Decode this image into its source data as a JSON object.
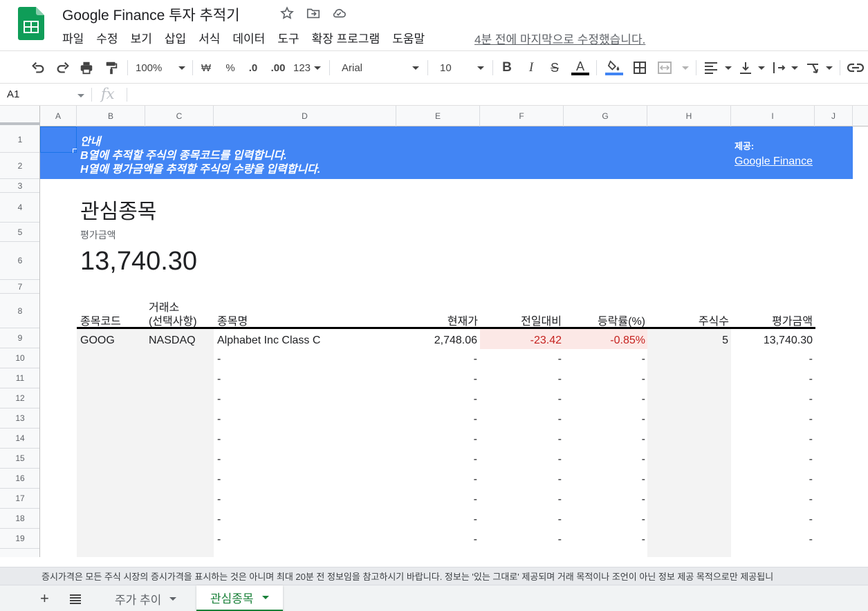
{
  "app": {
    "title": "Google Finance 투자 추적기",
    "last_edit": "4분 전에 마지막으로 수정했습니다."
  },
  "menu": [
    "파일",
    "수정",
    "보기",
    "삽입",
    "서식",
    "데이터",
    "도구",
    "확장 프로그램",
    "도움말"
  ],
  "toolbar": {
    "zoom": "100%",
    "currency": "₩",
    "percent": "%",
    "dec_decrease": ".0",
    "dec_increase": ".00",
    "format_more": "123",
    "font": "Arial",
    "font_size": "10"
  },
  "formula_bar": {
    "cell_ref": "A1",
    "fx": "fx"
  },
  "columns": [
    "A",
    "B",
    "C",
    "D",
    "E",
    "F",
    "G",
    "H",
    "I",
    "J"
  ],
  "rows": [
    "1",
    "2",
    "3",
    "4",
    "5",
    "6",
    "7",
    "8",
    "9",
    "10",
    "11",
    "12",
    "13",
    "14",
    "15",
    "16",
    "17",
    "18",
    "19"
  ],
  "banner": {
    "heading": "안내",
    "line1": "B열에 추적할 주식의 종목코드를 입력합니다.",
    "line2": "H열에 평가금액을 추적할 주식의 수량을 입력합니다.",
    "provided_label": "제공:",
    "provided_link": "Google Finance",
    "color": "#4285f4"
  },
  "summary": {
    "title": "관심종목",
    "value_label": "평가금액",
    "value": "13,740.30"
  },
  "table": {
    "headers": {
      "ticker": "종목코드",
      "exchange_line1": "거래소",
      "exchange_line2": "(선택사항)",
      "name": "종목명",
      "price": "현재가",
      "change": "전일대비",
      "change_pct": "등락률(%)",
      "shares": "주식수",
      "value": "평가금액"
    },
    "row": {
      "ticker": "GOOG",
      "exchange": "NASDAQ",
      "name": "Alphabet Inc Class C",
      "price": "2,748.06",
      "change": "-23.42",
      "change_pct": "-0.85%",
      "shares": "5",
      "value": "13,740.30"
    },
    "empty_placeholder": "-",
    "negative_color": "#c5221f",
    "negative_bg": "#fce8e6"
  },
  "disclaimer": "증시가격은 모든 주식 시장의 증시가격을 표시하는 것은 아니며 최대 20분 전 정보임을 참고하시기 바랍니다. 정보는 '있는 그대로' 제공되며 거래 목적이나 조언이 아닌 정보 제공 목적으로만 제공됩니",
  "tabs": [
    {
      "label": "주가 추이",
      "active": false
    },
    {
      "label": "관심종목",
      "active": true
    }
  ],
  "accent": "#188038"
}
